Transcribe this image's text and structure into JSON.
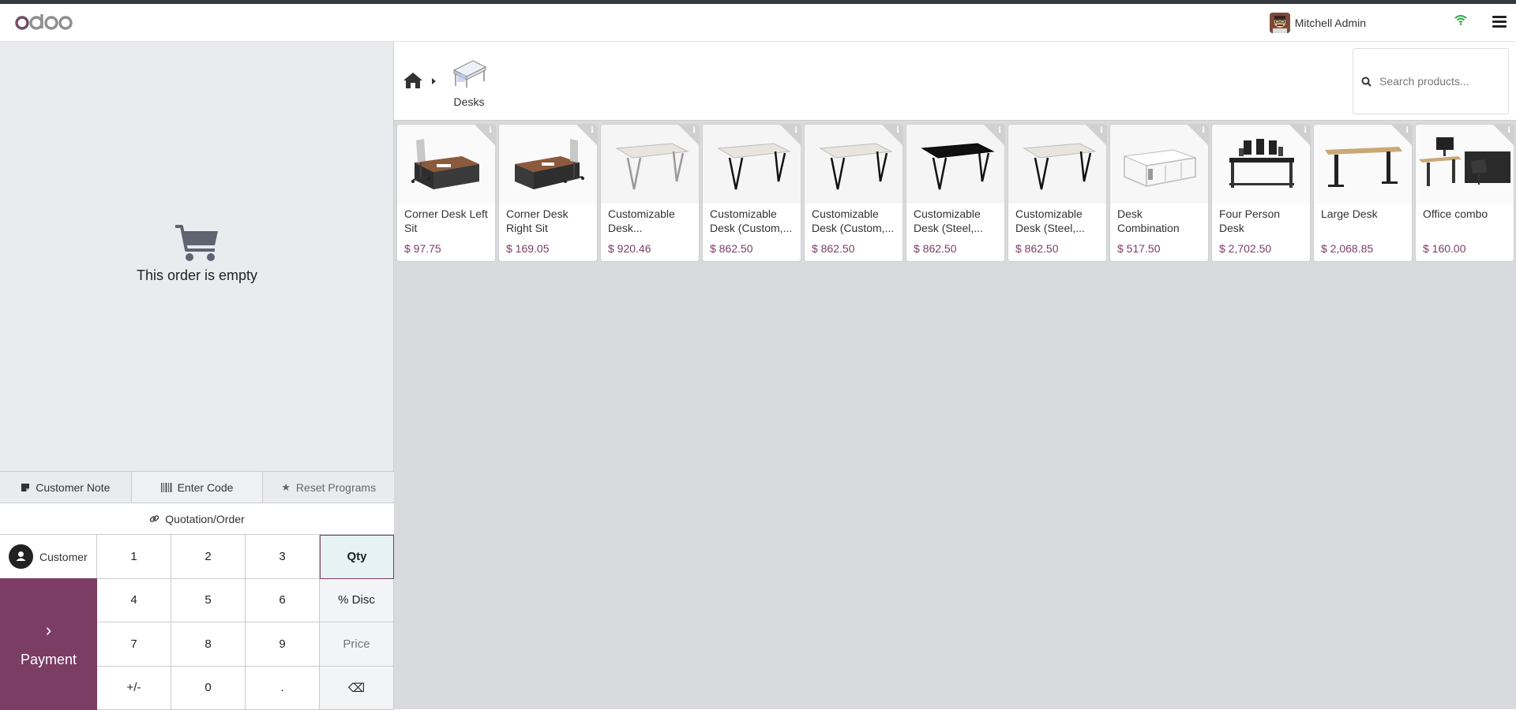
{
  "header": {
    "user_name": "Mitchell Admin"
  },
  "order": {
    "empty_message": "This order is empty"
  },
  "controls": {
    "customer_note": "Customer Note",
    "enter_code": "Enter Code",
    "reset_programs": "Reset Programs",
    "quotation_order": "Quotation/Order"
  },
  "pad": {
    "customer": "Customer",
    "payment": "Payment",
    "keys": [
      "1",
      "2",
      "3",
      "Qty",
      "4",
      "5",
      "6",
      "% Disc",
      "7",
      "8",
      "9",
      "Price",
      "+/-",
      "0",
      ".",
      "⌫"
    ],
    "active_mode": "Qty"
  },
  "breadcrumb": {
    "category": "Desks"
  },
  "search": {
    "placeholder": "Search products..."
  },
  "products": [
    {
      "name": "Corner Desk Left Sit",
      "price": "$ 97.75",
      "style": "corner-left"
    },
    {
      "name": "Corner Desk Right Sit",
      "price": "$ 169.05",
      "style": "corner-right"
    },
    {
      "name": "Customizable Desk...",
      "price": "$ 920.46",
      "style": "white-desk"
    },
    {
      "name": "Customizable Desk (Custom,...",
      "price": "$ 862.50",
      "style": "white-black-desk"
    },
    {
      "name": "Customizable Desk (Custom,...",
      "price": "$ 862.50",
      "style": "white-black-desk"
    },
    {
      "name": "Customizable Desk (Steel,...",
      "price": "$ 862.50",
      "style": "black-desk"
    },
    {
      "name": "Customizable Desk (Steel,...",
      "price": "$ 862.50",
      "style": "white-black-desk"
    },
    {
      "name": "Desk Combination",
      "price": "$ 517.50",
      "style": "combo"
    },
    {
      "name": "Four Person Desk",
      "price": "$ 2,702.50",
      "style": "four"
    },
    {
      "name": "Large Desk",
      "price": "$ 2,068.85",
      "style": "large"
    },
    {
      "name": "Office combo",
      "price": "$ 160.00",
      "style": "office"
    }
  ],
  "colors": {
    "brand": "#7b3d64",
    "pane_bg": "#e9ebef",
    "grid_bg": "#d8dadd"
  }
}
